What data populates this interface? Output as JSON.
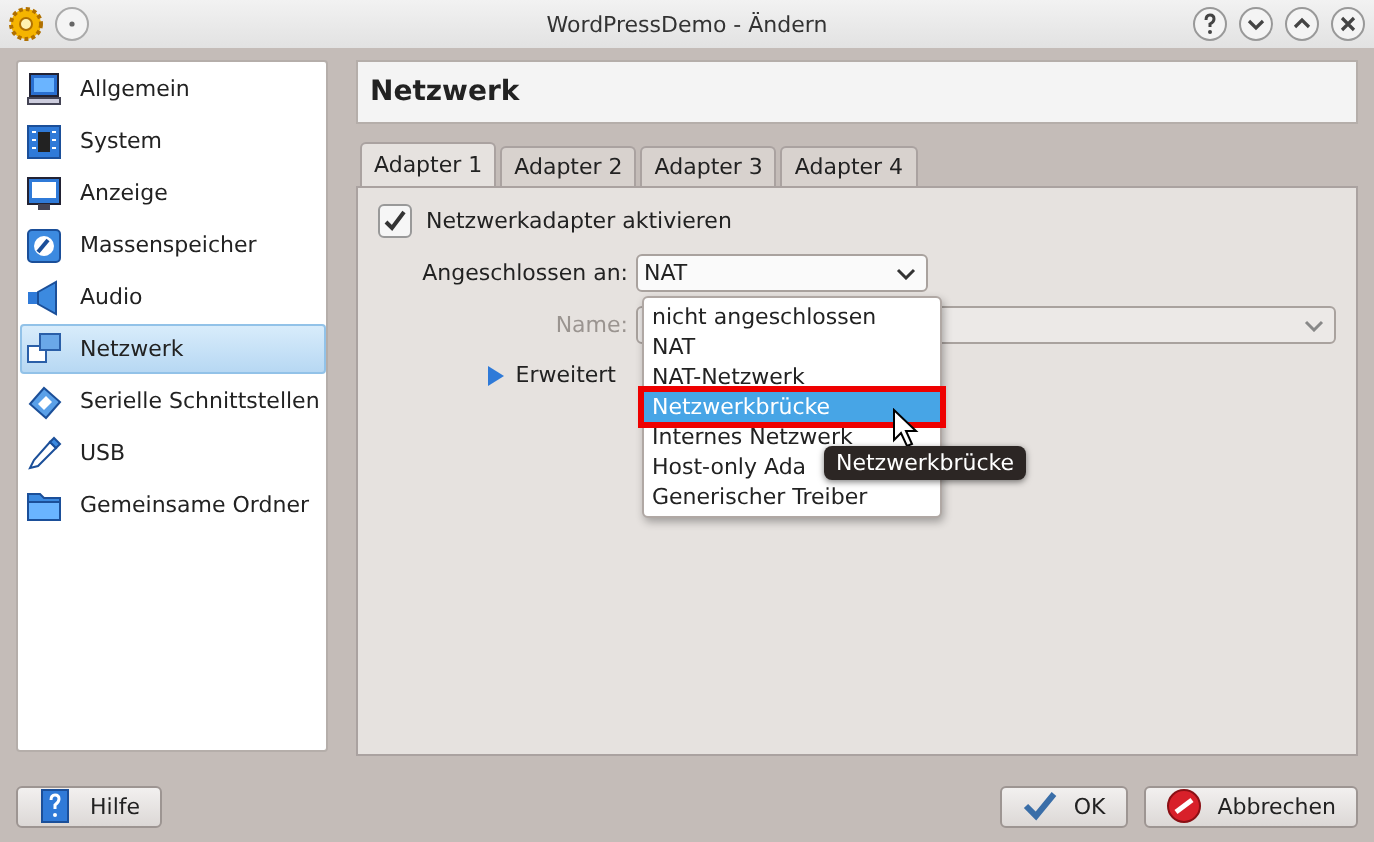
{
  "window": {
    "title": "WordPressDemo - Ändern"
  },
  "sidebar": {
    "items": [
      {
        "label": "Allgemein",
        "selected": false
      },
      {
        "label": "System",
        "selected": false
      },
      {
        "label": "Anzeige",
        "selected": false
      },
      {
        "label": "Massenspeicher",
        "selected": false
      },
      {
        "label": "Audio",
        "selected": false
      },
      {
        "label": "Netzwerk",
        "selected": true
      },
      {
        "label": "Serielle Schnittstellen",
        "selected": false
      },
      {
        "label": "USB",
        "selected": false
      },
      {
        "label": "Gemeinsame Ordner",
        "selected": false
      }
    ]
  },
  "header": {
    "title": "Netzwerk"
  },
  "tabs": [
    {
      "label": "Adapter 1",
      "selected": true
    },
    {
      "label": "Adapter 2",
      "selected": false
    },
    {
      "label": "Adapter 3",
      "selected": false
    },
    {
      "label": "Adapter 4",
      "selected": false
    }
  ],
  "enable_adapter": {
    "label": "Netzwerkadapter aktivieren",
    "checked": true
  },
  "attached_to": {
    "label": "Angeschlossen an:",
    "value": "NAT"
  },
  "name_field": {
    "label": "Name:",
    "disabled": true
  },
  "advanced": {
    "label": "Erweitert",
    "expanded": false
  },
  "dropdown": {
    "options": [
      {
        "label": "nicht angeschlossen",
        "selected": false
      },
      {
        "label": "NAT",
        "selected": false
      },
      {
        "label": "NAT-Netzwerk",
        "selected": false
      },
      {
        "label": "Netzwerkbrücke",
        "selected": true
      },
      {
        "label": "Internes Netzwerk",
        "selected": false
      },
      {
        "label": "Host-only Ada",
        "selected": false
      },
      {
        "label": "Generischer Treiber",
        "selected": false
      }
    ]
  },
  "tooltip": {
    "text": "Netzwerkbrücke"
  },
  "buttons": [
    {
      "label": "Hilfe",
      "kind": "help"
    },
    {
      "label": "OK",
      "kind": "ok"
    },
    {
      "label": "Abbrechen",
      "kind": "cancel"
    }
  ]
}
